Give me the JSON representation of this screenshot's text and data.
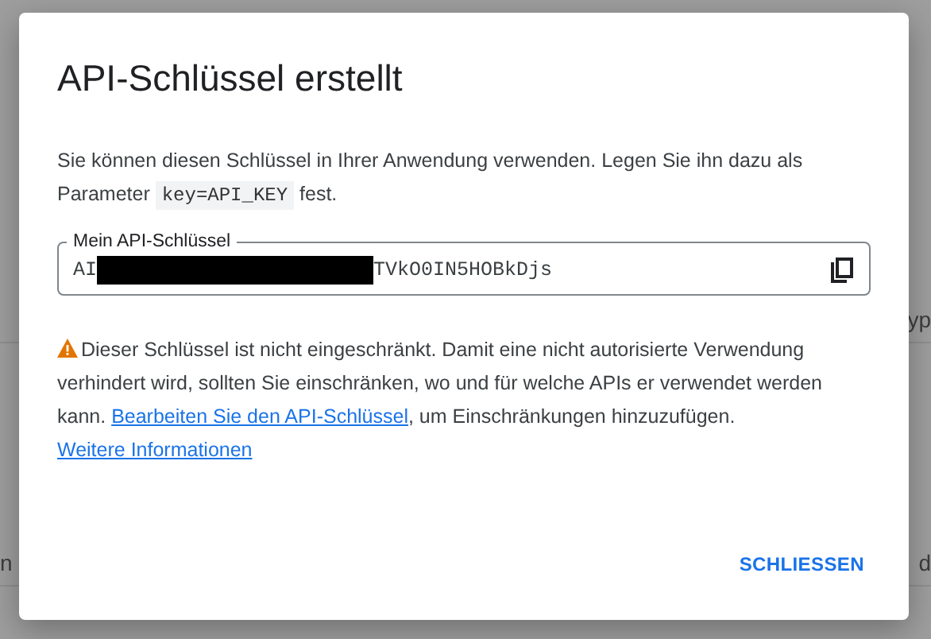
{
  "background_rows": [
    {
      "right": "yp"
    },
    {
      "left": "n",
      "right": "d"
    }
  ],
  "dialog": {
    "title": "API-Schlüssel erstellt",
    "intro_before": "Sie können diesen Schlüssel in Ihrer Anwendung verwenden. Legen Sie ihn dazu als Parameter",
    "intro_code": "key=API_KEY",
    "intro_after": "fest.",
    "key_field": {
      "label": "Mein API-Schlüssel",
      "value_start": "AI",
      "redacted": true,
      "value_end": "TVkO0IN5HOBkDjs"
    },
    "warning": {
      "text": "Dieser Schlüssel ist nicht eingeschränkt. Damit eine nicht autorisierte Verwendung verhindert wird, sollten Sie einschränken, wo und für welche APIs er verwendet werden kann.",
      "link": "Bearbeiten Sie den API-Schlüssel",
      "after_link": ", um Einschränkungen hinzuzufügen.",
      "more_link": "Weitere Informationen"
    },
    "buttons": [
      "SCHLIESSEN"
    ]
  }
}
